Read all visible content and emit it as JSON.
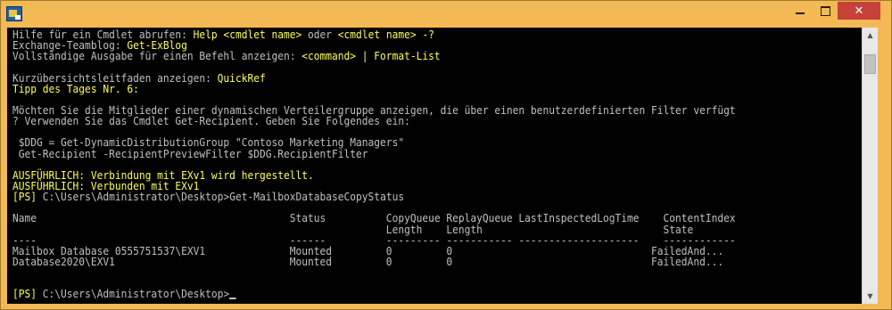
{
  "window": {
    "app_icon": "exchange-management-shell-icon",
    "controls": {
      "minimize": "minimize-icon",
      "maximize": "maximize-icon",
      "close": "✕"
    }
  },
  "console": {
    "lines": [
      {
        "color": "w",
        "parts": [
          [
            "w",
            "Hilfe für ein Cmdlet abrufen: "
          ],
          [
            "y",
            "Help <cmdlet name>"
          ],
          [
            "w",
            " oder "
          ],
          [
            "y",
            "<cmdlet name> -?"
          ]
        ]
      },
      {
        "color": "w",
        "parts": [
          [
            "w",
            "Exchange-Teamblog: "
          ],
          [
            "y",
            "Get-ExBlog"
          ]
        ]
      },
      {
        "color": "w",
        "parts": [
          [
            "w",
            "Vollständige Ausgabe für einen Befehl anzeigen: "
          ],
          [
            "y",
            "<command> | Format-List"
          ]
        ]
      },
      {
        "color": "w",
        "parts": [
          [
            "w",
            ""
          ]
        ]
      },
      {
        "color": "w",
        "parts": [
          [
            "w",
            "Kurzübersichtsleitfaden anzeigen: "
          ],
          [
            "y",
            "QuickRef"
          ]
        ]
      },
      {
        "color": "y",
        "parts": [
          [
            "y",
            "Tipp des Tages Nr. 6:"
          ]
        ]
      },
      {
        "color": "w",
        "parts": [
          [
            "w",
            ""
          ]
        ]
      },
      {
        "color": "w",
        "parts": [
          [
            "w",
            "Möchten Sie die Mitglieder einer dynamischen Verteilergruppe anzeigen, die über einen benutzerdefinierten Filter verfügt"
          ]
        ]
      },
      {
        "color": "w",
        "parts": [
          [
            "w",
            "? Verwenden Sie das Cmdlet Get-Recipient. Geben Sie Folgendes ein:"
          ]
        ]
      },
      {
        "color": "w",
        "parts": [
          [
            "w",
            ""
          ]
        ]
      },
      {
        "color": "w",
        "parts": [
          [
            "w",
            " $DDG = Get-DynamicDistributionGroup \"Contoso Marketing Managers\""
          ]
        ]
      },
      {
        "color": "w",
        "parts": [
          [
            "w",
            " Get-Recipient -RecipientPreviewFilter $DDG.RecipientFilter"
          ]
        ]
      },
      {
        "color": "w",
        "parts": [
          [
            "w",
            ""
          ]
        ]
      },
      {
        "color": "y",
        "parts": [
          [
            "y",
            "AUSFÜHRLICH: Verbindung mit EXv1 wird hergestellt."
          ]
        ]
      },
      {
        "color": "y",
        "parts": [
          [
            "y",
            "AUSFÜHRLICH: Verbunden mit EXv1"
          ]
        ]
      },
      {
        "color": "w",
        "parts": [
          [
            "y",
            "[PS]"
          ],
          [
            "w",
            " C:\\Users\\Administrator\\Desktop>Get-MailboxDatabaseCopyStatus"
          ]
        ]
      },
      {
        "color": "w",
        "parts": [
          [
            "w",
            ""
          ]
        ]
      },
      {
        "color": "w",
        "parts": [
          [
            "w",
            "Name                                          Status          CopyQueue ReplayQueue LastInspectedLogTime    ContentIndex"
          ]
        ]
      },
      {
        "color": "w",
        "parts": [
          [
            "w",
            "                                                              Length    Length                              State"
          ]
        ]
      },
      {
        "color": "w",
        "parts": [
          [
            "w",
            "----                                          ------          --------- ----------- --------------------    ------------"
          ]
        ]
      },
      {
        "color": "w",
        "parts": [
          [
            "w",
            "Mailbox Database 0555751537\\EXV1              Mounted         0         0                                 FailedAnd..."
          ]
        ]
      },
      {
        "color": "w",
        "parts": [
          [
            "w",
            "Database2020\\EXV1                             Mounted         0         0                                 FailedAnd..."
          ]
        ]
      },
      {
        "color": "w",
        "parts": [
          [
            "w",
            ""
          ]
        ]
      },
      {
        "color": "w",
        "parts": [
          [
            "w",
            ""
          ]
        ]
      },
      {
        "color": "w",
        "parts": [
          [
            "y",
            "[PS]"
          ],
          [
            "w",
            " C:\\Users\\Administrator\\Desktop>"
          ]
        ]
      }
    ]
  },
  "scrollbar": {
    "up": "▲",
    "down": "▼"
  }
}
